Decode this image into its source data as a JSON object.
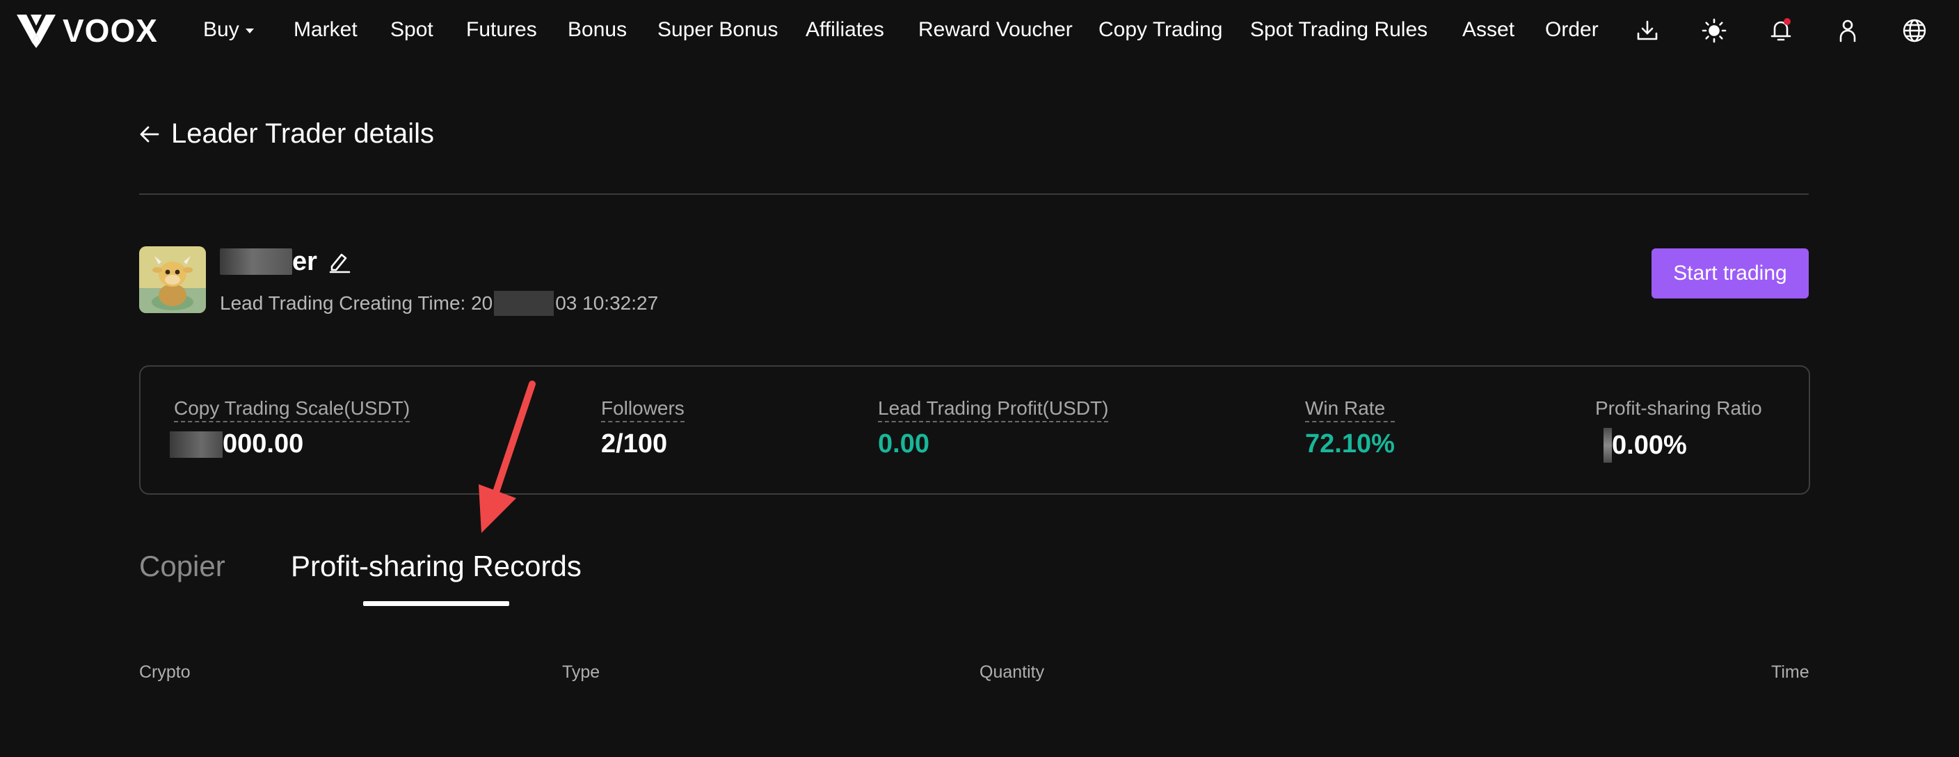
{
  "nav": {
    "logo_text": "VOOX",
    "items": [
      {
        "label": "Buy"
      },
      {
        "label": "Market"
      },
      {
        "label": "Spot"
      },
      {
        "label": "Futures"
      },
      {
        "label": "Bonus"
      },
      {
        "label": "Super Bonus"
      },
      {
        "label": "Affiliates"
      },
      {
        "label": "Reward Voucher"
      },
      {
        "label": "Copy Trading"
      },
      {
        "label": "Spot Trading Rules"
      },
      {
        "label": "Asset"
      },
      {
        "label": "Order"
      }
    ],
    "icons": [
      "download-icon",
      "theme-sun-icon",
      "bell-icon",
      "user-icon",
      "globe-icon"
    ],
    "notification_dot_color": "#e0203a"
  },
  "header": {
    "title": "Leader Trader details"
  },
  "profile": {
    "name_visible": "er",
    "created_label": "Lead Trading Creating Time: 20",
    "created_suffix": "03 10:32:27",
    "start_button": "Start trading"
  },
  "stats": {
    "scale_label": "Copy Trading Scale(USDT)",
    "scale_value": "000.00",
    "followers_label": "Followers",
    "followers_value": "2/100",
    "profit_label": "Lead Trading Profit(USDT)",
    "profit_value": "0.00",
    "winrate_label": "Win Rate",
    "winrate_value": "72.10%",
    "ratio_label": "Profit-sharing Ratio",
    "ratio_value": "0.00%"
  },
  "tabs": [
    {
      "label": "Copier",
      "active": false
    },
    {
      "label": "Profit-sharing Records",
      "active": true
    }
  ],
  "table": {
    "columns": [
      "Crypto",
      "Type",
      "Quantity",
      "Time"
    ]
  },
  "colors": {
    "background": "#111111",
    "accent_purple": "#9c5cf6",
    "positive_green": "#18b79a",
    "annotation_red": "#f04848"
  }
}
